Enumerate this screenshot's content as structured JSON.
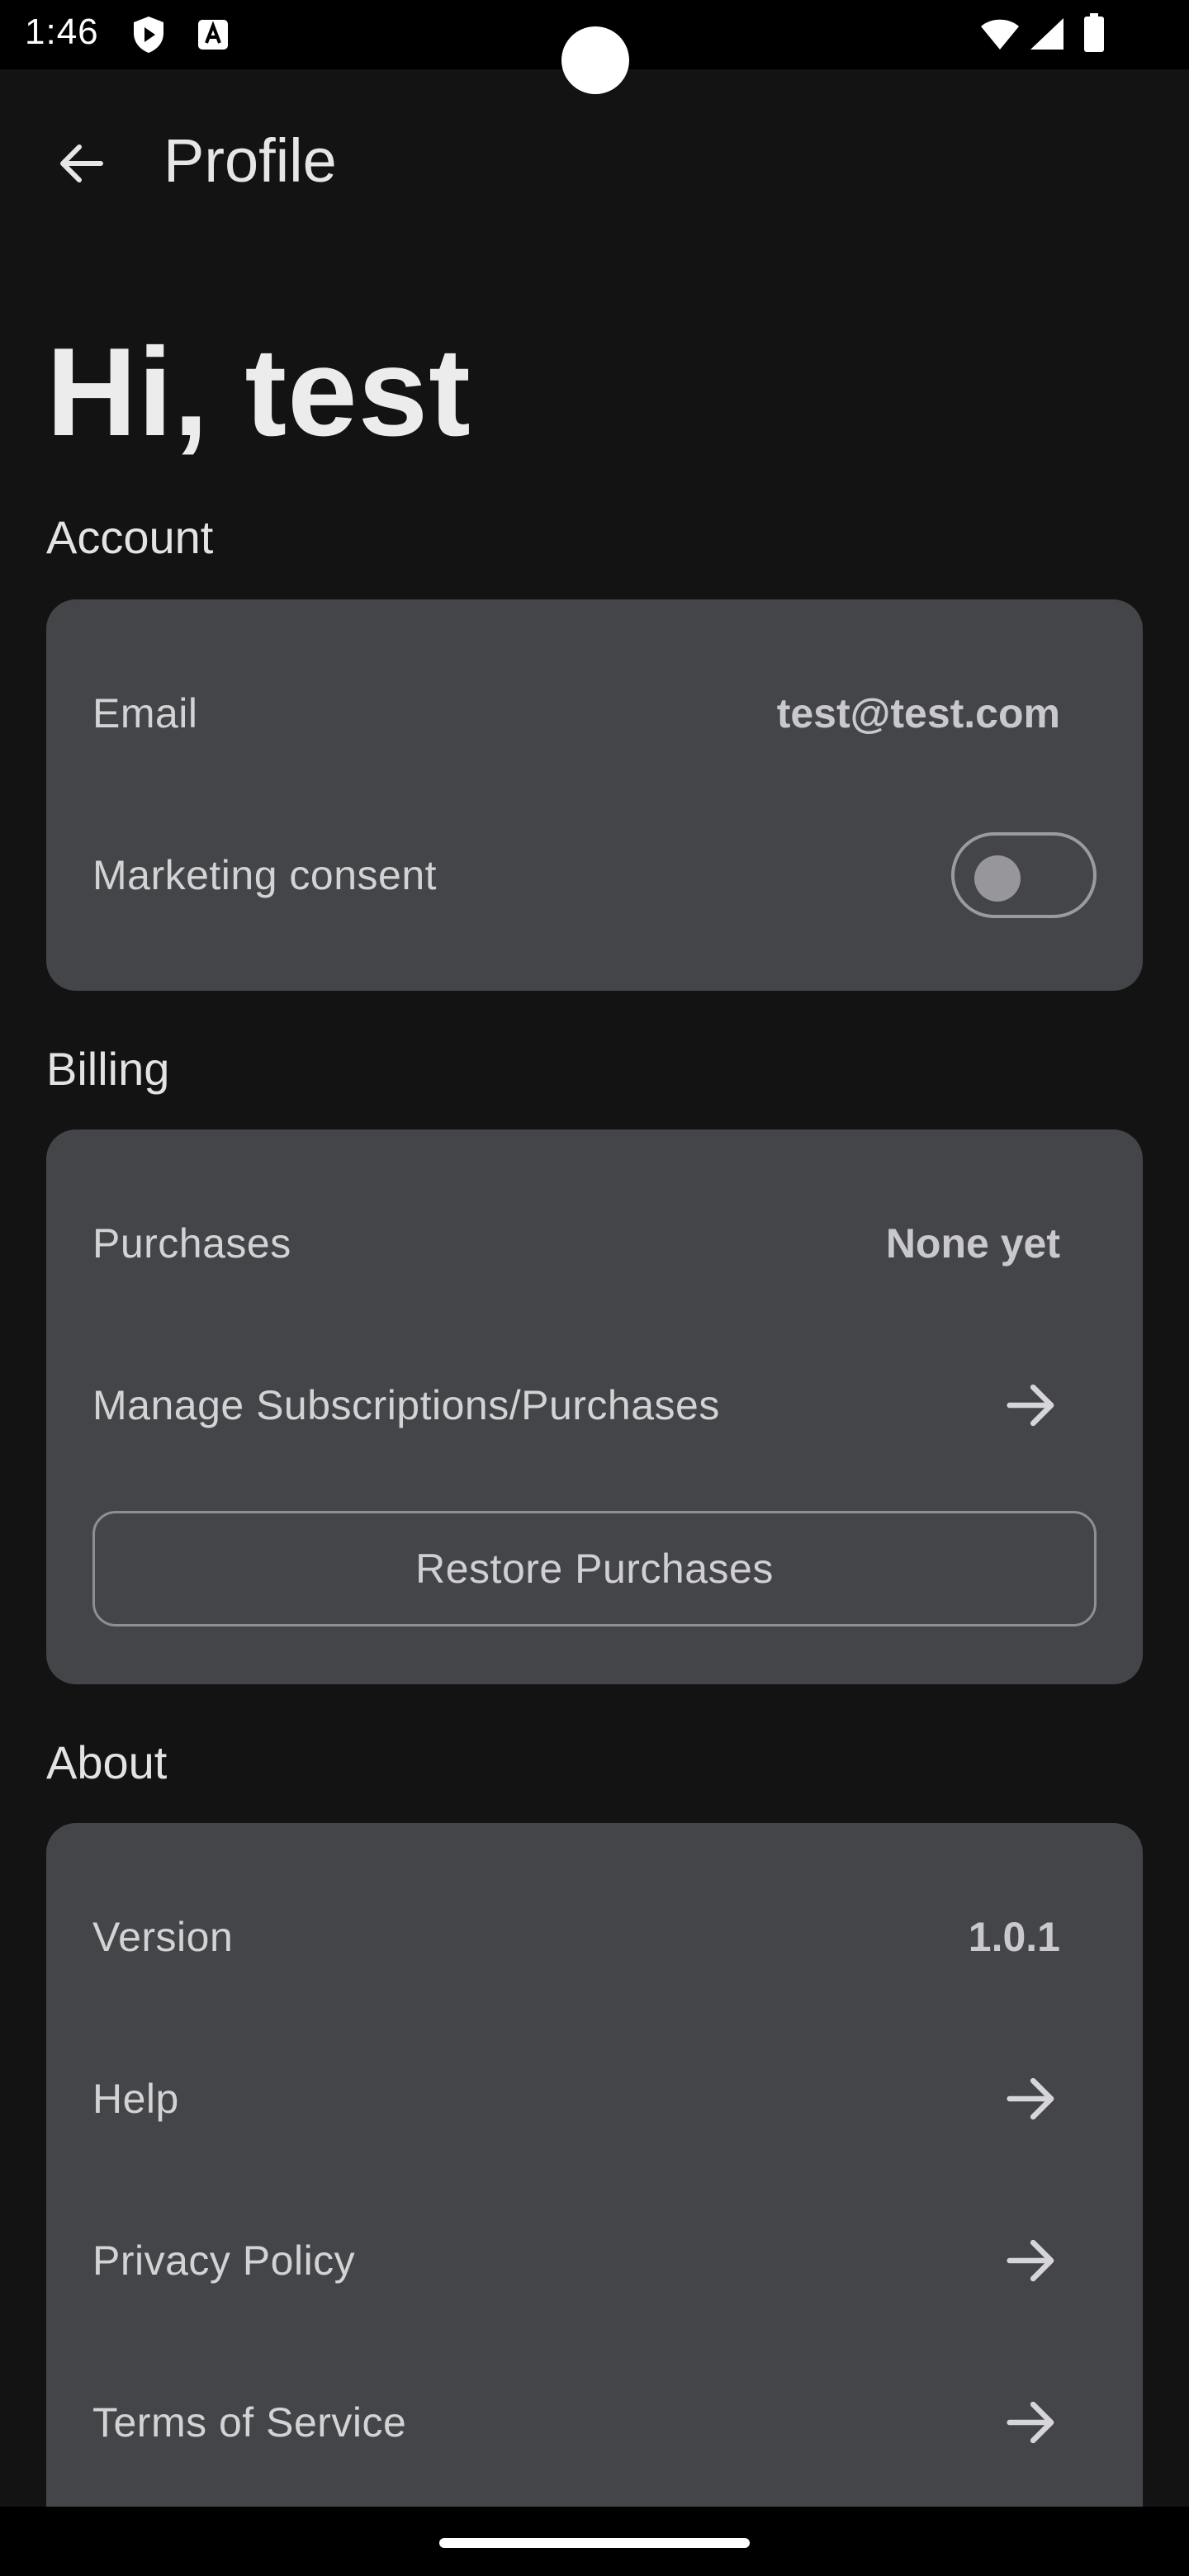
{
  "status_bar": {
    "time": "1:46",
    "icons": [
      "shield-play-icon",
      "accessibility-a-icon",
      "wifi-icon",
      "signal-icon",
      "battery-icon"
    ]
  },
  "app_bar": {
    "back_icon": "arrow-left-icon",
    "title": "Profile"
  },
  "greeting": "Hi, test",
  "sections": {
    "account": {
      "title": "Account",
      "email_label": "Email",
      "email_value": "test@test.com",
      "marketing_label": "Marketing consent",
      "marketing_enabled": false
    },
    "billing": {
      "title": "Billing",
      "purchases_label": "Purchases",
      "purchases_value": "None yet",
      "manage_label": "Manage Subscriptions/Purchases",
      "restore_label": "Restore Purchases"
    },
    "about": {
      "title": "About",
      "version_label": "Version",
      "version_value": "1.0.1",
      "help_label": "Help",
      "privacy_label": "Privacy Policy",
      "terms_label": "Terms of Service"
    }
  },
  "colors": {
    "background": "#131314",
    "card": "#444548",
    "text": "#e6e6e6"
  }
}
